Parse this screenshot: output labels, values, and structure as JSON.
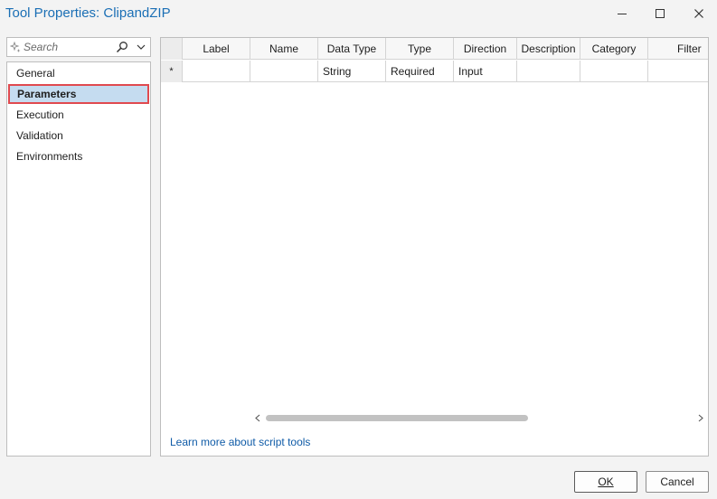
{
  "window": {
    "title": "Tool Properties: ClipandZIP",
    "controls": [
      {
        "name": "minimize",
        "icon": "minimize-icon"
      },
      {
        "name": "maximize",
        "icon": "maximize-icon"
      },
      {
        "name": "close",
        "icon": "close-icon"
      }
    ]
  },
  "search": {
    "placeholder": "Search",
    "value": ""
  },
  "sidebar": {
    "items": [
      {
        "label": "General",
        "selected": false
      },
      {
        "label": "Parameters",
        "selected": true
      },
      {
        "label": "Execution",
        "selected": false
      },
      {
        "label": "Validation",
        "selected": false
      },
      {
        "label": "Environments",
        "selected": false
      }
    ]
  },
  "grid": {
    "columns": [
      "Label",
      "Name",
      "Data Type",
      "Type",
      "Direction",
      "Description",
      "Category",
      "Filter"
    ],
    "rows": [
      {
        "marker": "*",
        "label": "",
        "name": "",
        "data_type": "String",
        "type": "Required",
        "direction": "Input",
        "description": "",
        "category": "",
        "filter": ""
      }
    ]
  },
  "links": {
    "learn_more": "Learn more about script tools"
  },
  "buttons": {
    "ok": "OK",
    "cancel": "Cancel"
  },
  "colors": {
    "title": "#1b6fb5",
    "selection": "#c5dcf0",
    "highlight_border": "#e04a4f",
    "link": "#0f5ba7"
  }
}
